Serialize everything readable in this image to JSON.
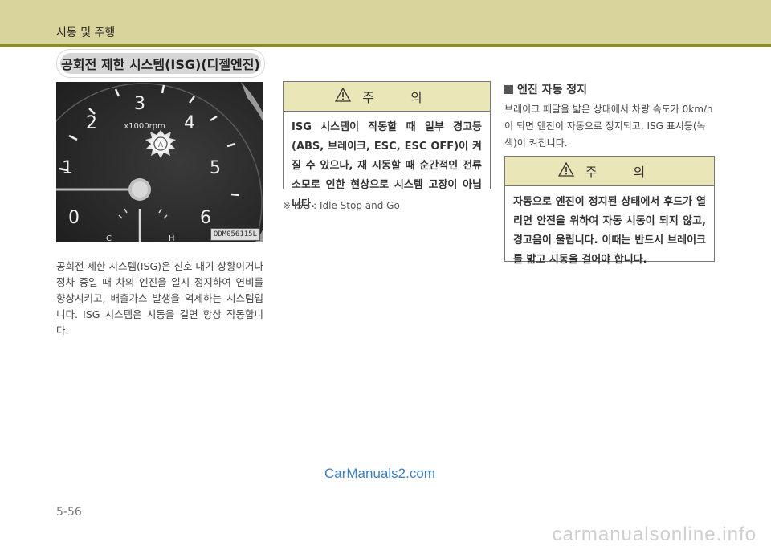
{
  "header": {
    "chapter_title": "시동 및 주행"
  },
  "section": {
    "title": "공회전 제한 시스템(ISG)(디젤엔진)"
  },
  "gauge": {
    "numbers": [
      "0",
      "1",
      "2",
      "3",
      "4",
      "5",
      "6"
    ],
    "unit_label": "x1000rpm",
    "temp_cold": "C",
    "temp_hot": "H",
    "image_code": "ODM056115L",
    "icon": "isg-indicator-icon"
  },
  "left": {
    "paragraph": "공회전 제한 시스템(ISG)은 신호 대기 상황이거나 정차 중일 때 차의 엔진을 일시 정지하여 연비를 향상시키고, 배출가스 발생을 억제하는 시스템입니다. ISG 시스템은 시동을 걸면 항상 작동합니다."
  },
  "caution1": {
    "title": "주 의",
    "body": "ISG 시스템이 작동할 때 일부 경고등(ABS, 브레이크, ESC, ESC OFF)이 켜질 수 있으나, 재 시동할 때 순간적인 전류 소모로 인한 현상으로 시스템 고장이 아닙니다."
  },
  "note": "※ ISG : Idle Stop and Go",
  "right": {
    "subheading": "엔진 자동 정지",
    "paragraph": "브레이크 페달을 밟은 상태에서 차량 속도가 0km/h 이 되면 엔진이 자동으로 정지되고, ISG 표시등(녹색)이 켜집니다."
  },
  "caution2": {
    "title": "주 의",
    "body": "자동으로 엔진이 정지된 상태에서 후드가 열리면 안전을 위하여 자동 시동이 되지 않고, 경고음이 울립니다. 이때는 반드시 브레이크를 밟고 시동을 걸어야 합니다."
  },
  "footer": {
    "page_number": "5-56",
    "watermark_site": "CarManuals2.com",
    "watermark_bottom": "carmanualsonline.info"
  },
  "colors": {
    "header_band": "#d9d49c",
    "header_rule": "#8a8a2e",
    "caution_head": "#ebe6b8",
    "watermark_blue": "#3f7fc4"
  }
}
